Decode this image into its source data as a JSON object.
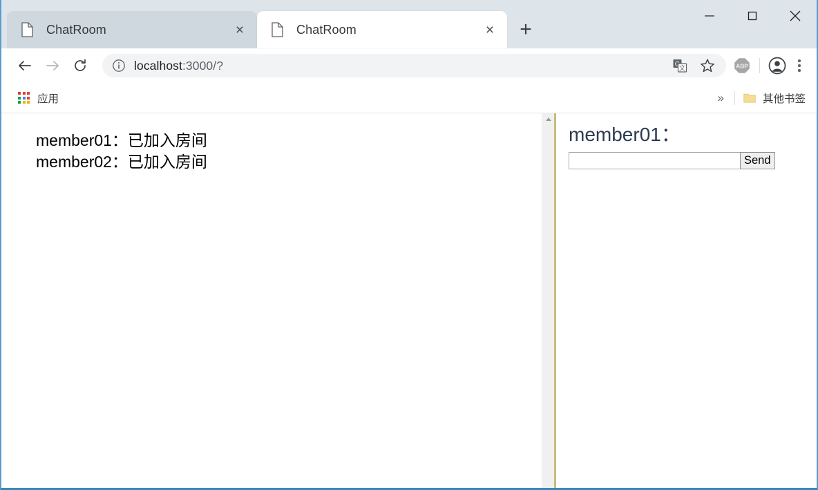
{
  "window": {
    "controls": {
      "minimize_label": "Minimize",
      "maximize_label": "Maximize",
      "close_label": "Close"
    }
  },
  "browser": {
    "tabs": [
      {
        "title": "ChatRoom",
        "active": false,
        "favicon": "page-icon",
        "close_label": "×"
      },
      {
        "title": "ChatRoom",
        "active": true,
        "favicon": "page-icon",
        "close_label": "×"
      }
    ],
    "new_tab_label": "+",
    "toolbar": {
      "back_label": "Back",
      "forward_label": "Forward",
      "reload_label": "Reload",
      "url_host": "localhost",
      "url_path": ":3000/?",
      "url_full": "localhost:3000/?",
      "site_info_icon": "info-circle-icon",
      "translate_icon": "translate-icon",
      "bookmark_star_icon": "star-icon",
      "extension_abp_label": "ABP",
      "profile_icon": "account-avatar-icon",
      "menu_icon": "three-dot-menu-icon"
    },
    "bookmarks_bar": {
      "apps_label": "应用",
      "overflow_label": "»",
      "other_bookmarks_label": "其他书签"
    }
  },
  "page": {
    "chat_log": {
      "messages": [
        "member01：已加入房间",
        "member02：已加入房间"
      ]
    },
    "compose": {
      "room_title": "member01：",
      "input_value": "",
      "input_placeholder": "",
      "send_label": "Send"
    },
    "colors": {
      "title_color": "#2c3a52",
      "divider_color": "#c9bc7c",
      "window_border": "#5b9bcd"
    }
  }
}
